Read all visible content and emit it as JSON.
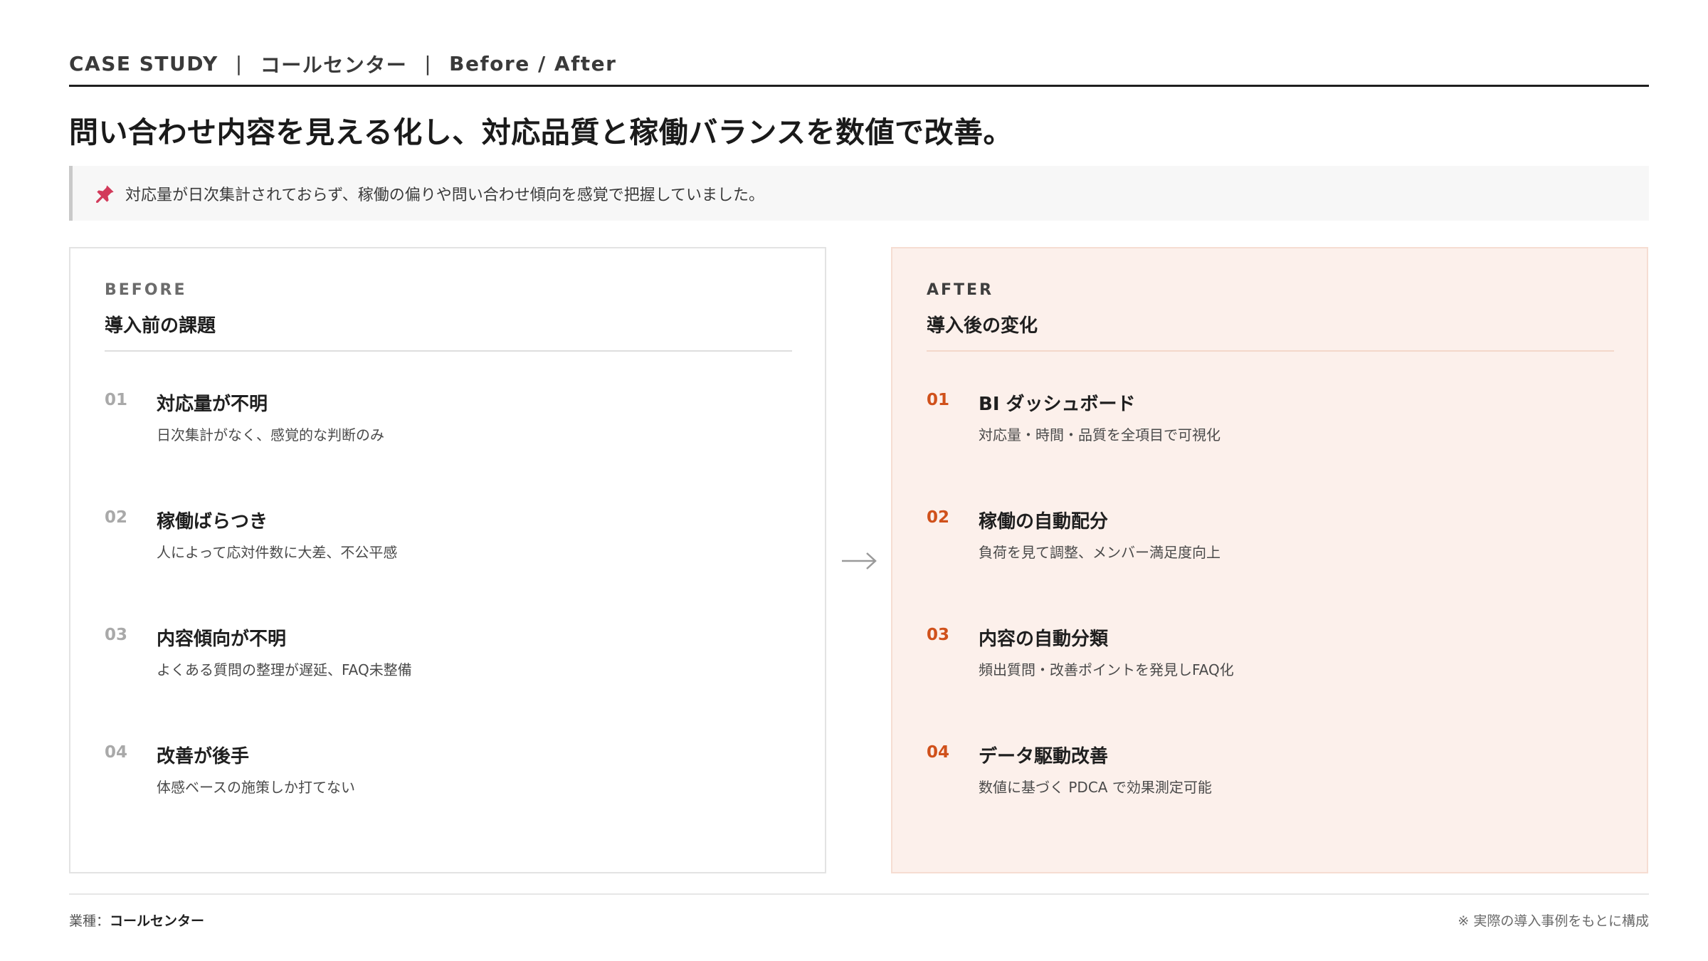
{
  "header": {
    "parts": [
      "CASE STUDY",
      "コールセンター",
      "Before / After"
    ],
    "separator": "|"
  },
  "headline": "問い合わせ内容を見える化し、対応品質と稼働バランスを数値で改善。",
  "callout": {
    "icon": "pushpin-icon",
    "text": "対応量が日次集計されておらず、稼働の偏りや問い合わせ傾向を感覚で把握していました。"
  },
  "before": {
    "tag": "BEFORE",
    "title": "導入前の課題",
    "items": [
      {
        "num": "01",
        "title": "対応量が不明",
        "desc": "日次集計がなく、感覚的な判断のみ"
      },
      {
        "num": "02",
        "title": "稼働ばらつき",
        "desc": "人によって応対件数に大差、不公平感"
      },
      {
        "num": "03",
        "title": "内容傾向が不明",
        "desc": "よくある質問の整理が遅延、FAQ未整備"
      },
      {
        "num": "04",
        "title": "改善が後手",
        "desc": "体感ベースの施策しか打てない"
      }
    ]
  },
  "after": {
    "tag": "AFTER",
    "title": "導入後の変化",
    "items": [
      {
        "num": "01",
        "title": "BI ダッシュボード",
        "desc": "対応量・時間・品質を全項目で可視化"
      },
      {
        "num": "02",
        "title": "稼働の自動配分",
        "desc": "負荷を見て調整、メンバー満足度向上"
      },
      {
        "num": "03",
        "title": "内容の自動分類",
        "desc": "頻出質問・改善ポイントを発見しFAQ化"
      },
      {
        "num": "04",
        "title": "データ駆動改善",
        "desc": "数値に基づく PDCA で効果測定可能"
      }
    ]
  },
  "footer": {
    "industry_label": "業種：",
    "industry_value": "コールセンター",
    "note": "※ 実際の導入事例をもとに構成"
  },
  "colors": {
    "accent": "#d0511b",
    "after_bg": "#fcf0eb",
    "pin": "#d23a5a"
  }
}
